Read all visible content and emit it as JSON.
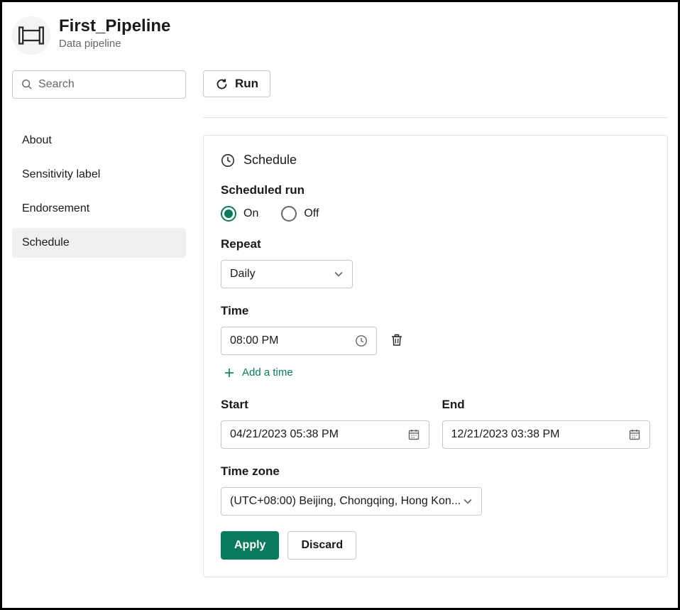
{
  "header": {
    "title": "First_Pipeline",
    "subtitle": "Data pipeline"
  },
  "search": {
    "placeholder": "Search",
    "value": ""
  },
  "sidebar": {
    "items": [
      {
        "label": "About",
        "selected": false
      },
      {
        "label": "Sensitivity label",
        "selected": false
      },
      {
        "label": "Endorsement",
        "selected": false
      },
      {
        "label": "Schedule",
        "selected": true
      }
    ]
  },
  "toolbar": {
    "run_label": "Run"
  },
  "schedule": {
    "title": "Schedule",
    "scheduled_run_label": "Scheduled run",
    "on_label": "On",
    "off_label": "Off",
    "scheduled_run_value": "On",
    "repeat_label": "Repeat",
    "repeat_value": "Daily",
    "time_label": "Time",
    "times": [
      "08:00 PM"
    ],
    "add_time_label": "Add a time",
    "start_label": "Start",
    "start_value": "04/21/2023 05:38 PM",
    "end_label": "End",
    "end_value": "12/21/2023 03:38 PM",
    "timezone_label": "Time zone",
    "timezone_value": "(UTC+08:00) Beijing, Chongqing, Hong Kon...",
    "apply_label": "Apply",
    "discard_label": "Discard"
  }
}
